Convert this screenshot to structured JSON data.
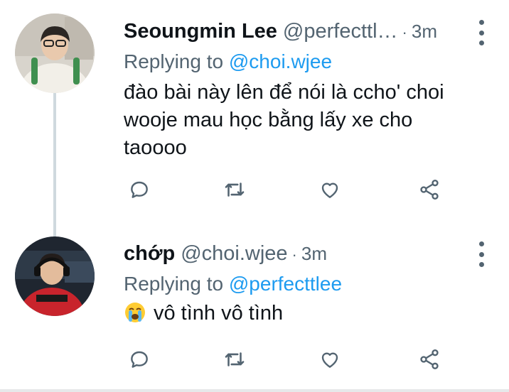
{
  "tweets": [
    {
      "author_name": "Seoungmin Lee",
      "handle": "@perfecttl…",
      "separator": "·",
      "time": "3m",
      "replying_label": "Replying to",
      "replying_to": "@choi.wjee",
      "text": "đào bài này lên để nói là ccho' choi wooje mau học bằng lấy xe cho taoooo",
      "avatar_icon": "profile-photo-seoungmin"
    },
    {
      "author_name": "chớp",
      "handle": "@choi.wjee",
      "separator": "·",
      "time": "3m",
      "replying_label": "Replying to",
      "replying_to": "@perfecttlee",
      "text": "vô tình vô tình",
      "emoji_icon": "loudly-crying-face-emoji",
      "avatar_icon": "profile-photo-chop"
    }
  ],
  "action_icons": [
    "reply-icon",
    "retweet-icon",
    "like-icon",
    "share-icon"
  ],
  "colors": {
    "text_primary": "#0f1419",
    "text_secondary": "#536471",
    "accent": "#1d9bf0",
    "thread_line": "#cfd9de"
  }
}
